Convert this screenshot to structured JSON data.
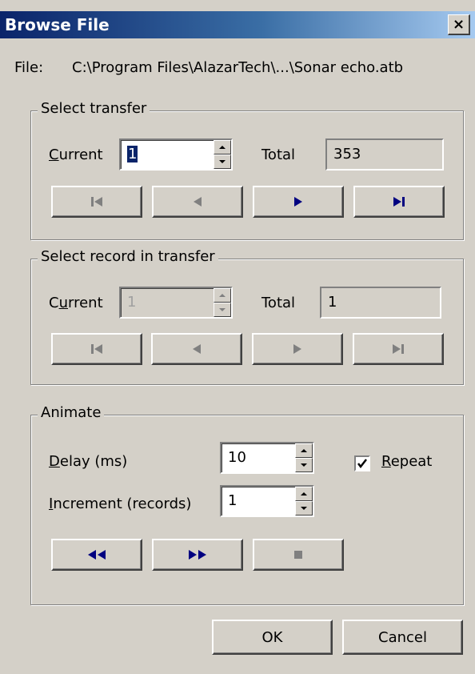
{
  "window": {
    "title": "Browse File",
    "close_glyph": "×"
  },
  "file": {
    "label": "File:",
    "path": "C:\\Program Files\\AlazarTech\\...\\Sonar echo.atb"
  },
  "select_transfer": {
    "legend": "Select transfer",
    "current_label_accel": "C",
    "current_label_rest": "urrent",
    "current_value": "1",
    "total_label": "Total",
    "total_value": "353",
    "nav_icons": [
      "first-icon",
      "previous-icon",
      "next-icon",
      "last-icon"
    ]
  },
  "select_record": {
    "legend": "Select record in transfer",
    "current_label_pre": "C",
    "current_label_accel": "u",
    "current_label_rest": "rrent",
    "current_value": "1",
    "total_label": "Total",
    "total_value": "1",
    "nav_icons": [
      "first-icon",
      "previous-icon",
      "next-icon",
      "last-icon"
    ],
    "enabled": false
  },
  "animate": {
    "legend": "Animate",
    "delay_label_accel": "D",
    "delay_label_rest": "elay (ms)",
    "delay_value": "10",
    "increment_label_accel": "I",
    "increment_label_rest": "ncrement (records)",
    "increment_value": "1",
    "repeat_label_accel": "R",
    "repeat_label_rest": "epeat",
    "repeat_checked": true,
    "controls": [
      "rewind-icon",
      "fast-forward-icon",
      "stop-icon"
    ]
  },
  "buttons": {
    "ok": "OK",
    "cancel": "Cancel"
  },
  "colors": {
    "title_start": "#0a246a",
    "title_end": "#a6caf0",
    "face": "#d4d0c8",
    "accent_blue": "#000080",
    "disabled": "#808080"
  }
}
